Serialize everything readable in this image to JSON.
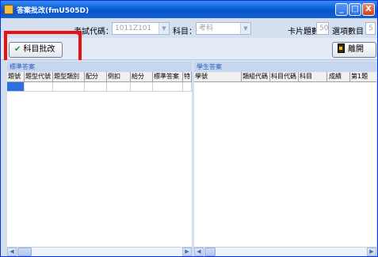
{
  "window": {
    "title": "答案批改(fmU505D)",
    "controls": {
      "minimize": "_",
      "maximize": "□",
      "close": "X"
    }
  },
  "filters": {
    "exam_code_label": "考試代碼：",
    "exam_code_value": "1011Z101",
    "subject_label": "科目：",
    "subject_value": "考科",
    "card_count_label": "卡片題數",
    "card_count_value": "50",
    "option_count_label": "選項數目",
    "option_count_value": "5"
  },
  "toolbar": {
    "grade_button_label": "科目批改",
    "grade_button_icon": "check-icon",
    "exit_button_label": "離開",
    "exit_button_icon": "door-icon"
  },
  "left_panel": {
    "title": "標準答案",
    "columns": [
      "題號",
      "題型代號",
      "題型類別",
      "配分",
      "倒扣",
      "給分",
      "標準答案",
      "特"
    ]
  },
  "right_panel": {
    "title": "學生答案",
    "columns": [
      "學號",
      "類組代碼",
      "科目代碼",
      "科目",
      "",
      "成績",
      "第1題"
    ]
  },
  "colors": {
    "titlebar": "#0a5fd8",
    "highlight": "#e81010",
    "selection": "#2d6ee0"
  }
}
